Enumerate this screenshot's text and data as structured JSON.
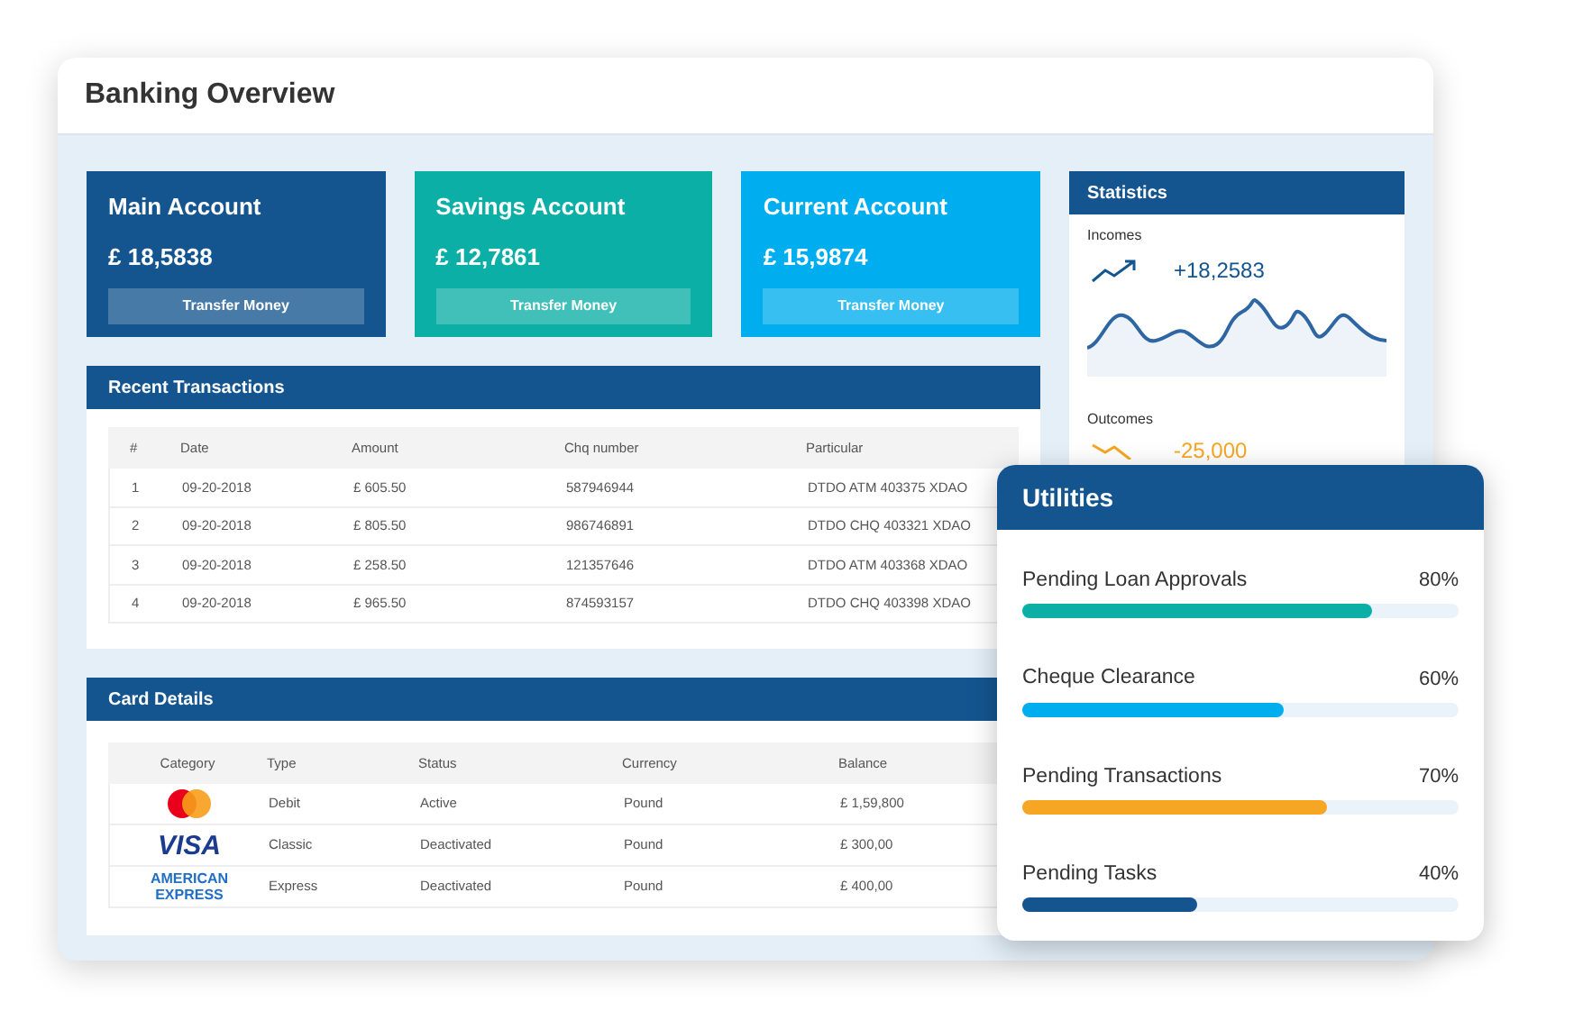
{
  "window": {
    "title": "Banking Overview"
  },
  "accounts": [
    {
      "name": "Main Account",
      "balance": "£ 18,5838",
      "button": "Transfer Money",
      "color": "#14558f"
    },
    {
      "name": "Savings Account",
      "balance": "£ 12,7861",
      "button": "Transfer Money",
      "color": "#0bafa5"
    },
    {
      "name": "Current Account",
      "balance": "£ 15,9874",
      "button": "Transfer Money",
      "color": "#00adef"
    }
  ],
  "transactions": {
    "title": "Recent Transactions",
    "columns": [
      "#",
      "Date",
      "Amount",
      "Chq number",
      "Particular"
    ],
    "rows": [
      [
        "1",
        "09-20-2018",
        "£ 605.50",
        "587946944",
        "DTDO ATM 403375 XDAO"
      ],
      [
        "2",
        "09-20-2018",
        "£ 805.50",
        "986746891",
        "DTDO CHQ 403321 XDAO"
      ],
      [
        "3",
        "09-20-2018",
        "£ 258.50",
        "121357646",
        "DTDO ATM 403368 XDAO"
      ],
      [
        "4",
        "09-20-2018",
        "£ 965.50",
        "874593157",
        "DTDO CHQ 403398 XDAO"
      ]
    ]
  },
  "cards": {
    "title": "Card Details",
    "columns": [
      "Category",
      "Type",
      "Status",
      "Currency",
      "Balance"
    ],
    "rows": [
      {
        "kind": "mastercard",
        "type": "Debit",
        "status": "Active",
        "currency": "Pound",
        "balance": "£ 1,59,800"
      },
      {
        "kind": "visa",
        "logo_text": "VISA",
        "type": "Classic",
        "status": "Deactivated",
        "currency": "Pound",
        "balance": "£ 300,00"
      },
      {
        "kind": "amex",
        "logo_text": "AMERICAN EXPRESS",
        "type": "Express",
        "status": "Deactivated",
        "currency": "Pound",
        "balance": "£ 400,00"
      }
    ]
  },
  "statistics": {
    "title": "Statistics",
    "incomes": {
      "label": "Incomes",
      "value": "+18,2583"
    },
    "outcomes": {
      "label": "Outcomes",
      "value": "-25,000"
    }
  },
  "utilities": {
    "title": "Utilities",
    "items": [
      {
        "label": "Pending Loan Approvals",
        "reading": "80%",
        "level": 0.8,
        "color": "#0bafa5"
      },
      {
        "label": "Cheque Clearance",
        "reading": "60%",
        "level": 0.6,
        "color": "#00adef"
      },
      {
        "label": "Pending Transactions",
        "reading": "70%",
        "level": 0.7,
        "color": "#f6a623"
      },
      {
        "label": "Pending Tasks",
        "reading": "40%",
        "level": 0.4,
        "color": "#14558f"
      }
    ]
  }
}
